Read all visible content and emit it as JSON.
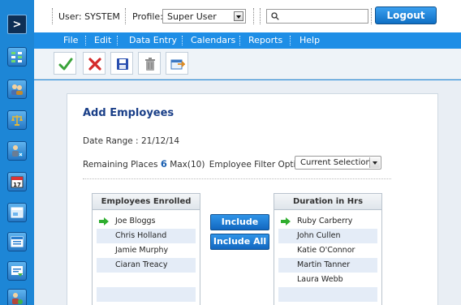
{
  "sidebar": {
    "toggle_label": ">",
    "items": [
      {
        "icon": "org-chart-icon"
      },
      {
        "icon": "users-icon"
      },
      {
        "icon": "scales-icon"
      },
      {
        "icon": "remove-user-icon"
      },
      {
        "icon": "calendar-icon"
      },
      {
        "icon": "window-icon"
      },
      {
        "icon": "list-window-icon"
      },
      {
        "icon": "report-icon"
      },
      {
        "icon": "user-settings-icon"
      }
    ]
  },
  "header": {
    "user_label": "User: SYSTEM",
    "profile_label": "Profile:",
    "profile_value": "Super User",
    "search_placeholder": "",
    "logout_label": "Logout"
  },
  "menu": {
    "items": [
      "File",
      "Edit",
      "Data Entry",
      "Calendars",
      "Reports",
      "Help"
    ]
  },
  "toolbar": {
    "buttons": [
      "confirm-icon",
      "delete-icon",
      "save-icon",
      "trash-icon",
      "transfer-icon"
    ]
  },
  "form": {
    "title": "Add Employees",
    "date_range_label": "Date Range :",
    "date_range_value": "21/12/14",
    "remaining_label": "Remaining Places",
    "remaining_value": "6",
    "max_text": "Max(10)",
    "filter_label": "Employee Filter Options",
    "filter_value": "Current Selection",
    "include_label": "Include",
    "include_all_label": "Include All"
  },
  "enrolled": {
    "header": "Employees Enrolled",
    "items": [
      "Joe Bloggs",
      "Chris Holland",
      "Jamie Murphy",
      "Ciaran Treacy"
    ]
  },
  "available": {
    "header": "Duration in Hrs",
    "items": [
      "Ruby Carberry",
      "John Cullen",
      "Katie O'Connor",
      "Martin Tanner",
      "Laura Webb"
    ]
  },
  "colors": {
    "brand_blue": "#1e8ee6",
    "title_blue": "#1a3f88",
    "row_highlight": "#e4ecf7",
    "arrow_green": "#2fae2f"
  }
}
